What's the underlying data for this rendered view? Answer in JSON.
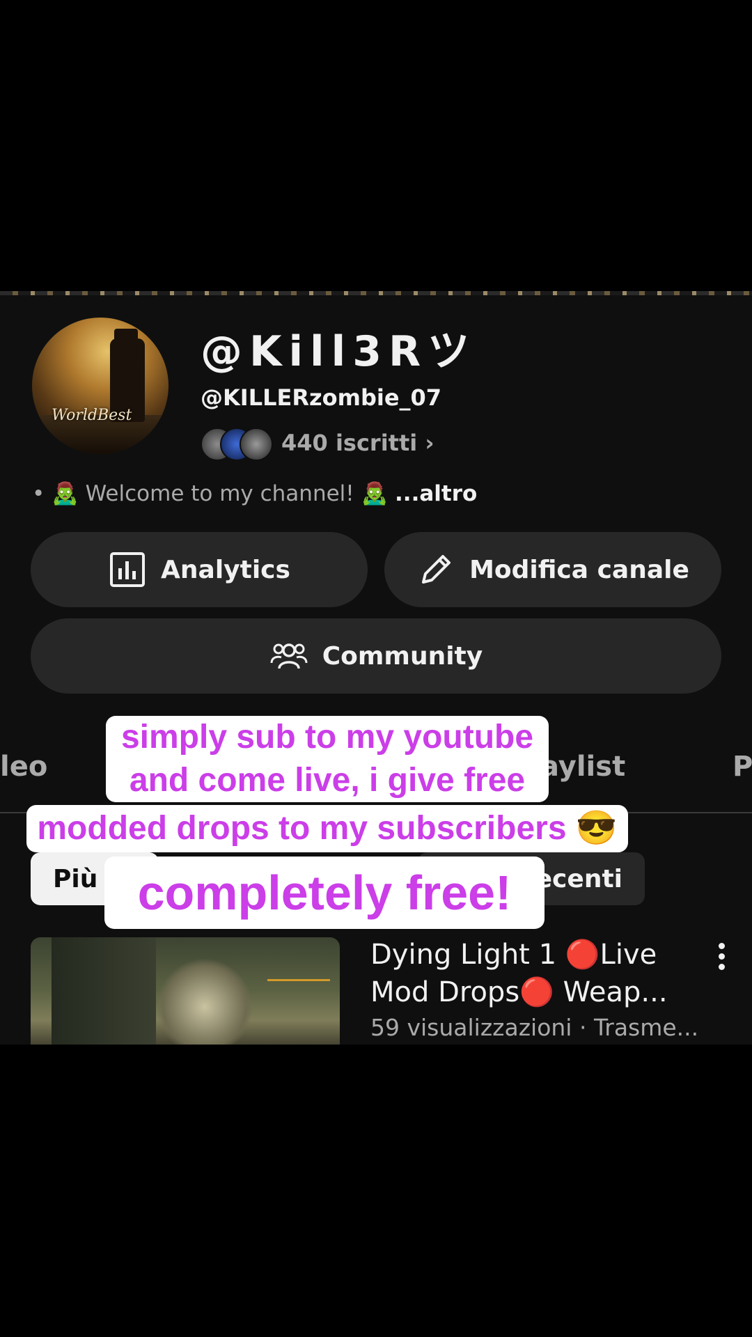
{
  "channel": {
    "name": "@Kill3Rツ",
    "handle": "@KILLERzombie_07",
    "subscribers": "440 iscritti ›",
    "description": "• 🧟‍♂️ Welcome to my channel! 🧟‍♂️",
    "description_more": "...altro",
    "avatar_text": "WorldBest"
  },
  "actions": {
    "analytics": "Analytics",
    "edit_channel": "Modifica canale",
    "community": "Community"
  },
  "tabs": {
    "video": "leo",
    "playlist": "aylist",
    "next": "P"
  },
  "chips": {
    "more": "Più",
    "recent": "ecenti"
  },
  "video": {
    "title": "Dying Light 1 🔴Live Mod Drops🔴 Weap...",
    "meta": "59 visualizzazioni · Trasme..."
  },
  "caption": {
    "line1": "simply sub to my youtube and come live, i give free",
    "line2": "modded drops to my subscribers 😎",
    "line3": "completely free!"
  },
  "icons": [
    "analytics-icon",
    "pencil-icon",
    "community-icon",
    "kebab-menu-icon"
  ],
  "colors": {
    "background": "#0f0f0f",
    "button": "#272727",
    "caption_text": "#cb3ee8",
    "caption_bg": "#ffffff",
    "muted_text": "#aaaaaa"
  }
}
